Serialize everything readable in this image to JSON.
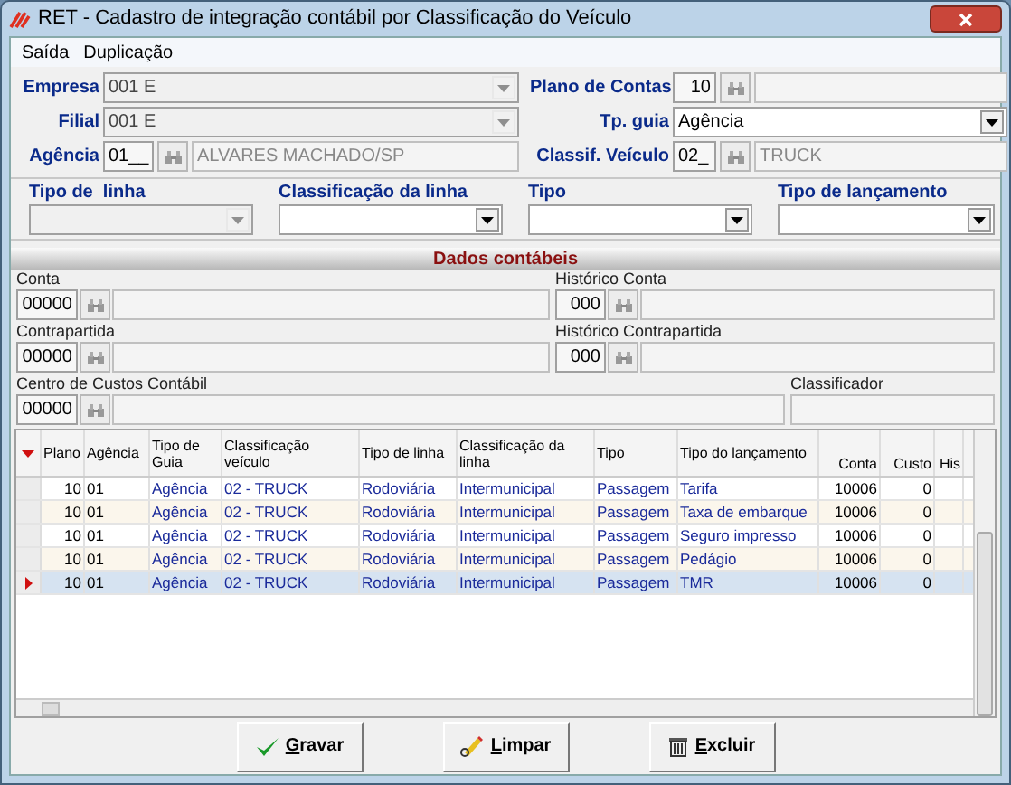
{
  "window": {
    "title": "RET - Cadastro de integração contábil por Classificação do Veículo"
  },
  "menu": [
    "Saída",
    "Duplicação"
  ],
  "header": {
    "empresa": {
      "label": "Empresa",
      "value": "001 E"
    },
    "filial": {
      "label": "Filial",
      "value": "001 E"
    },
    "agencia": {
      "label": "Agência",
      "code": "01__",
      "description": "ALVARES MACHADO/SP"
    },
    "plano": {
      "label": "Plano de Contas",
      "code": "10"
    },
    "tp_guia": {
      "label": "Tp. guia",
      "value": "Agência"
    },
    "classif": {
      "label": "Classif. Veículo",
      "code": "02_",
      "description": "TRUCK"
    }
  },
  "filters": [
    {
      "label": "Tipo de  linha"
    },
    {
      "label": "Classificação da linha"
    },
    {
      "label": "Tipo"
    },
    {
      "label": "Tipo de lançamento"
    }
  ],
  "section_title": "Dados contábeis",
  "accounting": {
    "conta": {
      "label": "Conta",
      "code": "00000"
    },
    "historico_conta": {
      "label": "Histórico Conta",
      "code": "000"
    },
    "contrapartida": {
      "label": "Contrapartida",
      "code": "00000"
    },
    "historico_contrapartida": {
      "label": "Histórico Contrapartida",
      "code": "000"
    },
    "centro": {
      "label": "Centro de Custos Contábil",
      "code": "00000"
    },
    "classificador": {
      "label": "Classificador"
    }
  },
  "table": {
    "columns": [
      "Plano",
      "Agência",
      "Tipo de Guia",
      "Classificação veículo",
      "Tipo de linha",
      "Classificação da linha",
      "Tipo",
      "Tipo do lançamento",
      "Conta",
      "Custo",
      "His"
    ],
    "rows": [
      {
        "selected": false,
        "cells": [
          "10",
          "01",
          "Agência",
          "02  - TRUCK",
          "Rodoviária",
          "Intermunicipal",
          "Passagem",
          "Tarifa",
          "10006",
          "0",
          ""
        ]
      },
      {
        "selected": false,
        "cells": [
          "10",
          "01",
          "Agência",
          "02  - TRUCK",
          "Rodoviária",
          "Intermunicipal",
          "Passagem",
          "Taxa de embarque",
          "10006",
          "0",
          ""
        ]
      },
      {
        "selected": false,
        "cells": [
          "10",
          "01",
          "Agência",
          "02  - TRUCK",
          "Rodoviária",
          "Intermunicipal",
          "Passagem",
          "Seguro impresso",
          "10006",
          "0",
          ""
        ]
      },
      {
        "selected": false,
        "cells": [
          "10",
          "01",
          "Agência",
          "02  - TRUCK",
          "Rodoviária",
          "Intermunicipal",
          "Passagem",
          "Pedágio",
          "10006",
          "0",
          ""
        ]
      },
      {
        "selected": true,
        "cells": [
          "10",
          "01",
          "Agência",
          "02  - TRUCK",
          "Rodoviária",
          "Intermunicipal",
          "Passagem",
          "TMR",
          "10006",
          "0",
          ""
        ]
      }
    ]
  },
  "buttons": [
    {
      "kind": "save",
      "label": "Gravar"
    },
    {
      "kind": "clear",
      "label": "Limpar"
    },
    {
      "kind": "delete",
      "label": "Excluir"
    }
  ]
}
